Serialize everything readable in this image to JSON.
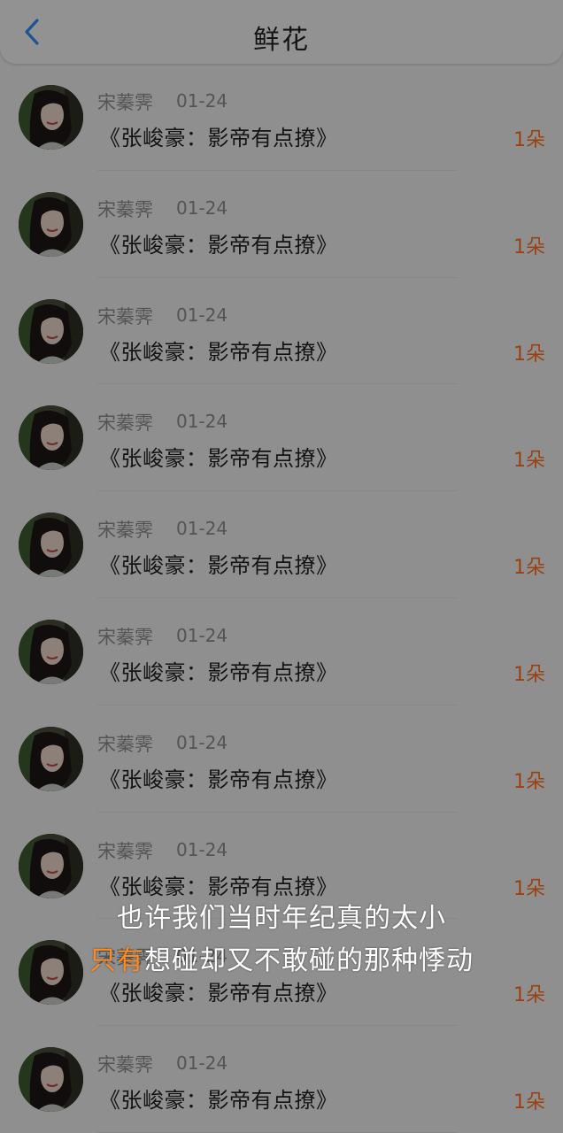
{
  "header": {
    "title": "鲜花",
    "back_icon": "chevron-left-icon"
  },
  "colors": {
    "accent_blue": "#2f8cf0",
    "flower_count_orange": "#ff6d1f",
    "subtitle_highlight": "#ff8a1f"
  },
  "items": [
    {
      "name": "宋蓁霁",
      "date": "01-24",
      "title": "《张峻豪：影帝有点撩》",
      "count": "1朵"
    },
    {
      "name": "宋蓁霁",
      "date": "01-24",
      "title": "《张峻豪：影帝有点撩》",
      "count": "1朵"
    },
    {
      "name": "宋蓁霁",
      "date": "01-24",
      "title": "《张峻豪：影帝有点撩》",
      "count": "1朵"
    },
    {
      "name": "宋蓁霁",
      "date": "01-24",
      "title": "《张峻豪：影帝有点撩》",
      "count": "1朵"
    },
    {
      "name": "宋蓁霁",
      "date": "01-24",
      "title": "《张峻豪：影帝有点撩》",
      "count": "1朵"
    },
    {
      "name": "宋蓁霁",
      "date": "01-24",
      "title": "《张峻豪：影帝有点撩》",
      "count": "1朵"
    },
    {
      "name": "宋蓁霁",
      "date": "01-24",
      "title": "《张峻豪：影帝有点撩》",
      "count": "1朵"
    },
    {
      "name": "宋蓁霁",
      "date": "01-24",
      "title": "《张峻豪：影帝有点撩》",
      "count": "1朵"
    },
    {
      "name": "宋蓁霁",
      "date": "01-24",
      "title": "《张峻豪：影帝有点撩》",
      "count": "1朵"
    },
    {
      "name": "宋蓁霁",
      "date": "01-24",
      "title": "《张峻豪：影帝有点撩》",
      "count": "1朵"
    }
  ],
  "subtitles": {
    "line1": "也许我们当时年纪真的太小",
    "line2_highlight": "只有",
    "line2_rest": "想碰却又不敢碰的那种悸动"
  }
}
